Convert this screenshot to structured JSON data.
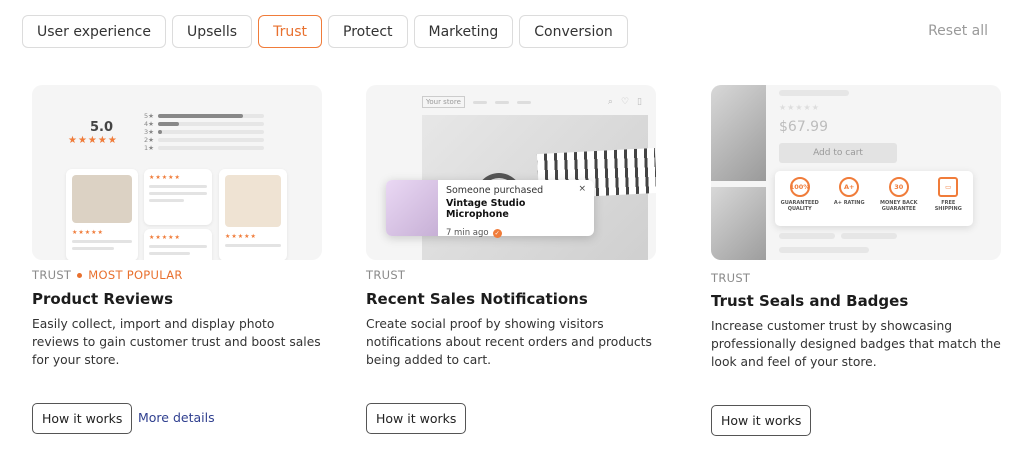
{
  "filters": {
    "chips": [
      "User experience",
      "Upsells",
      "Trust",
      "Protect",
      "Marketing",
      "Conversion"
    ],
    "active": "Trust",
    "reset_label": "Reset all"
  },
  "colors": {
    "accent": "#f07c3a",
    "link": "#2f3f8f"
  },
  "cards": [
    {
      "category": "TRUST",
      "badge": "MOST POPULAR",
      "title": "Product Reviews",
      "description": "Easily collect, import and display photo reviews to gain customer trust and boost sales for your store.",
      "primary_button": "How it works",
      "secondary_link": "More details",
      "preview": {
        "rating": "5.0",
        "stars": "★★★★★",
        "rating_rows": [
          {
            "label": "5★",
            "fraction": 0.8
          },
          {
            "label": "4★",
            "fraction": 0.2
          },
          {
            "label": "3★",
            "fraction": 0.04
          },
          {
            "label": "2★",
            "fraction": 0
          },
          {
            "label": "1★",
            "fraction": 0
          }
        ]
      }
    },
    {
      "category": "TRUST",
      "title": "Recent Sales Notifications",
      "description": "Create social proof by showing visitors notifications about recent orders and products being added to cart.",
      "primary_button": "How it works",
      "preview": {
        "store_label": "Your store",
        "popup_heading": "Someone purchased",
        "popup_product": "Vintage Studio Microphone",
        "popup_time": "7 min ago",
        "close_glyph": "×"
      }
    },
    {
      "category": "TRUST",
      "title": "Trust Seals and Badges",
      "description": "Increase customer trust by showcasing professionally designed badges that match the look and feel of your store.",
      "primary_button": "How it works",
      "preview": {
        "price": "$67.99",
        "add_to_cart": "Add to cart",
        "stars": "★★★★★",
        "badges": [
          {
            "icon": "100%",
            "label": "GUARANTEED QUALITY"
          },
          {
            "icon": "A+",
            "label": "A+ RATING"
          },
          {
            "icon": "30",
            "label": "MONEY BACK GUARANTEE"
          },
          {
            "icon": "▭",
            "label": "FREE SHIPPING"
          }
        ]
      }
    }
  ]
}
